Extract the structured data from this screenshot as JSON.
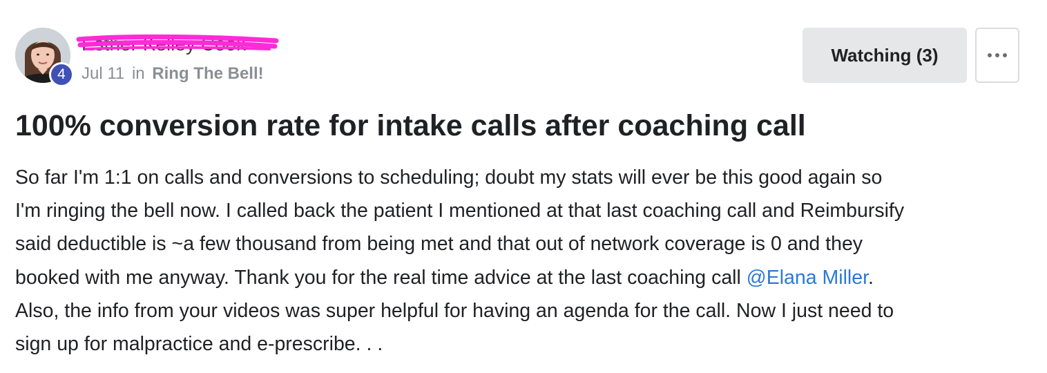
{
  "author": {
    "name": "Esther Kelley Cook",
    "level": "4",
    "avatar_icon": "user-photo-icon"
  },
  "meta": {
    "date": "Jul 11",
    "in_word": "in",
    "category": "Ring The Bell!"
  },
  "actions": {
    "watch_label": "Watching (3)",
    "more_icon": "more-horizontal-icon"
  },
  "post": {
    "title": "100% conversion rate for intake calls after coaching call",
    "body_lines": [
      "So far I'm 1:1 on calls and conversions to scheduling; doubt my stats will ever be this good again so",
      "I'm ringing the bell now. I called back the patient I mentioned at that last coaching call and Reimbursify",
      "said deductible is ~a few thousand from being met and that out of network coverage is 0 and they",
      "booked with me anyway. Thank you for the real time advice at the last coaching call ",
      "Also, the info from your videos was super helpful for having an agenda for the call. Now I just need to",
      "sign up for malpractice and e-prescribe. . ."
    ],
    "mention": "@Elana Miller",
    "after_mention": "."
  },
  "colors": {
    "badge": "#3f51b5",
    "mention": "#2a7ad6",
    "redaction": "#ff2bd6",
    "watch_button_bg": "#e6e7e8"
  }
}
